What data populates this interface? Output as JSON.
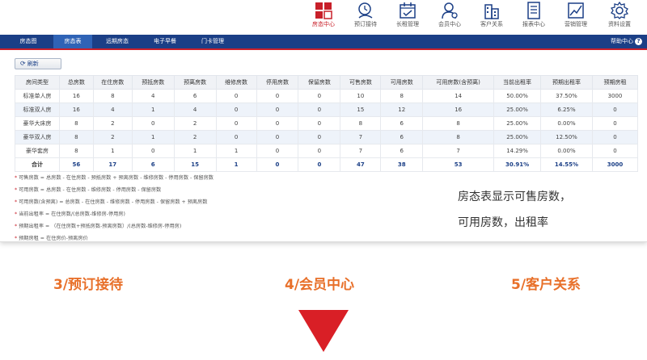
{
  "toolbar": {
    "items": [
      {
        "label": "房态中心",
        "icon": "room-status-icon",
        "active": true
      },
      {
        "label": "预订接待",
        "icon": "reception-icon"
      },
      {
        "label": "长租管理",
        "icon": "calendar-icon"
      },
      {
        "label": "会员中心",
        "icon": "member-icon"
      },
      {
        "label": "客户关系",
        "icon": "building-icon"
      },
      {
        "label": "报表中心",
        "icon": "report-icon"
      },
      {
        "label": "营销管理",
        "icon": "chart-icon"
      },
      {
        "label": "资料设置",
        "icon": "gear-icon"
      }
    ]
  },
  "nav": {
    "tabs": [
      "房态图",
      "房态表",
      "远期房态",
      "电子早餐",
      "门卡管理"
    ],
    "active": 1,
    "help": "帮助中心",
    "help_icon": "?"
  },
  "refresh_label": "刷新",
  "table": {
    "headers": [
      "房间类型",
      "总房数",
      "在住房数",
      "预抵房数",
      "预离房数",
      "维修房数",
      "停用房数",
      "保留房数",
      "可售房数",
      "可用房数",
      "可用房数(含预离)",
      "当前出租率",
      "预期出租率",
      "预期房租"
    ],
    "rows": [
      [
        "标准单人房",
        "16",
        "8",
        "4",
        "6",
        "0",
        "0",
        "0",
        "10",
        "8",
        "14",
        "50.00%",
        "37.50%",
        "3000"
      ],
      [
        "标准双人房",
        "16",
        "4",
        "1",
        "4",
        "0",
        "0",
        "0",
        "15",
        "12",
        "16",
        "25.00%",
        "6.25%",
        "0"
      ],
      [
        "豪华大床房",
        "8",
        "2",
        "0",
        "2",
        "0",
        "0",
        "0",
        "8",
        "6",
        "8",
        "25.00%",
        "0.00%",
        "0"
      ],
      [
        "豪华双人房",
        "8",
        "2",
        "1",
        "2",
        "0",
        "0",
        "0",
        "7",
        "6",
        "8",
        "25.00%",
        "12.50%",
        "0"
      ],
      [
        "豪华套房",
        "8",
        "1",
        "0",
        "1",
        "1",
        "0",
        "0",
        "7",
        "6",
        "7",
        "14.29%",
        "0.00%",
        "0"
      ]
    ],
    "total": [
      "合计",
      "56",
      "17",
      "6",
      "15",
      "1",
      "0",
      "0",
      "47",
      "38",
      "53",
      "30.91%",
      "14.55%",
      "3000"
    ]
  },
  "notes": [
    "可售房数 = 总房数 - 在住房数 - 预抵房数 + 预离房数 - 维修房数 - 停用房数 - 保留房数",
    "可用房数 = 总房数 - 在住房数 - 维修房数 - 停用房数 - 保留房数",
    "可用房数(含预离) = 总房数 - 在住房数 - 维修房数 - 停用房数 - 保留房数 + 预离房数",
    "当前出租率 = 在住房数/(总房数-维修房-停用房)",
    "预期出租率 = （在住房数+预抵房数-预离房数）/(总房数-维修房-停用房)",
    "预期房租 = 在住房价-预离房价"
  ],
  "caption": [
    "房态表显示可售房数，",
    "可用房数，出租率"
  ],
  "features": [
    "3/预订接待",
    "4/会员中心",
    "5/客户关系"
  ],
  "colors": {
    "nav_blue": "#1b3f86",
    "accent_red": "#c8202a",
    "feature_orange": "#e8702a"
  }
}
